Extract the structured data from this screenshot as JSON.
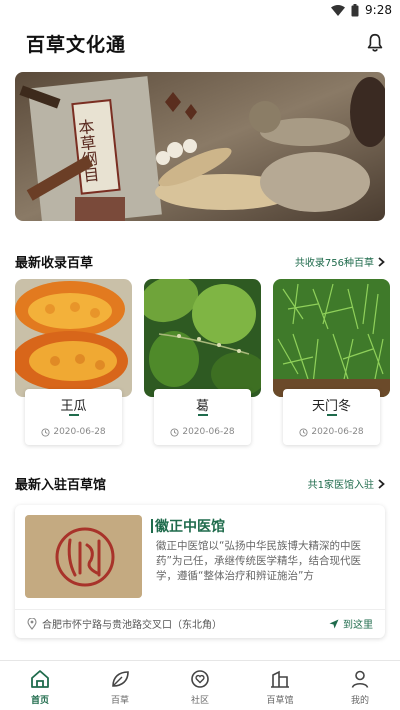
{
  "status_bar": {
    "time": "9:28"
  },
  "header": {
    "title": "百草文化通"
  },
  "banner": {
    "text": "本草纲目"
  },
  "latest_herbs": {
    "title": "最新收录百草",
    "link": "共收录756种百草",
    "items": [
      {
        "name": "王瓜",
        "date": "2020-06-28"
      },
      {
        "name": "葛",
        "date": "2020-06-28"
      },
      {
        "name": "天门冬",
        "date": "2020-06-28"
      }
    ]
  },
  "latest_clinics": {
    "title": "最新入驻百草馆",
    "link": "共1家医馆入驻",
    "clinic": {
      "name": "徽正中医馆",
      "description": "徽正中医馆以“弘扬中华民族博大精深的中医药”为己任，承继传统医学精华，结合现代医学，遵循“整体治疗和辨证施治”方",
      "address": "合肥市怀宁路与贵池路交叉口（东北角）",
      "go_label": "到这里"
    }
  },
  "tabbar": {
    "tabs": [
      {
        "label": "首页"
      },
      {
        "label": "百草"
      },
      {
        "label": "社区"
      },
      {
        "label": "百草馆"
      },
      {
        "label": "我的"
      }
    ]
  },
  "colors": {
    "accent": "#1f6b4c"
  }
}
